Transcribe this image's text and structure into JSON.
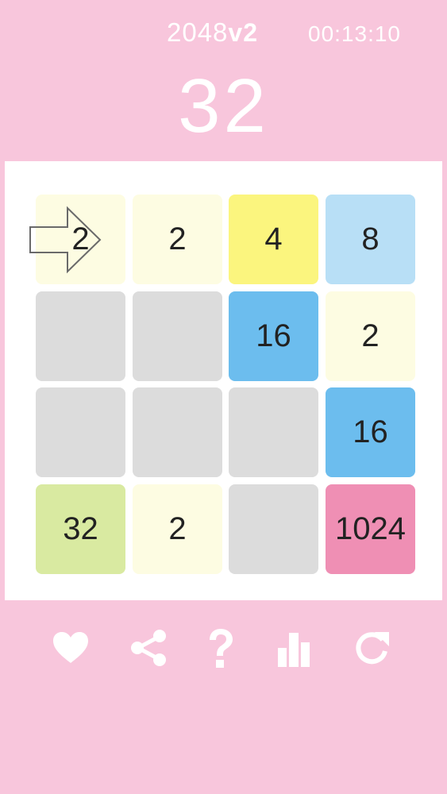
{
  "header": {
    "title_main": "2048",
    "title_version": "v2",
    "timer": "00:13:10"
  },
  "score": "32",
  "board": {
    "rows": 4,
    "cols": 4,
    "tiles": [
      [
        "2",
        "2",
        "4",
        "8"
      ],
      [
        "",
        "",
        "16",
        "2"
      ],
      [
        "",
        "",
        "",
        "16"
      ],
      [
        "32",
        "2",
        "",
        "1024"
      ]
    ],
    "colors": {
      "empty": "#dcdcdc",
      "2": "#fdfce2",
      "4": "#fbf57e",
      "8": "#b8dff6",
      "16": "#6cbdee",
      "32": "#d9eaa1",
      "1024": "#ef8fb4"
    }
  },
  "hint": {
    "direction": "right",
    "icon": "arrow-right-icon"
  },
  "actions": [
    {
      "name": "favorite-button",
      "icon": "heart-icon"
    },
    {
      "name": "share-button",
      "icon": "share-icon"
    },
    {
      "name": "help-button",
      "icon": "question-icon"
    },
    {
      "name": "leaderboard-button",
      "icon": "bar-chart-icon"
    },
    {
      "name": "restart-button",
      "icon": "refresh-icon"
    }
  ],
  "theme": {
    "background": "#f8c6dc",
    "board_background": "#ffffff",
    "text_light": "#ffffff",
    "tile_text": "#222222"
  }
}
